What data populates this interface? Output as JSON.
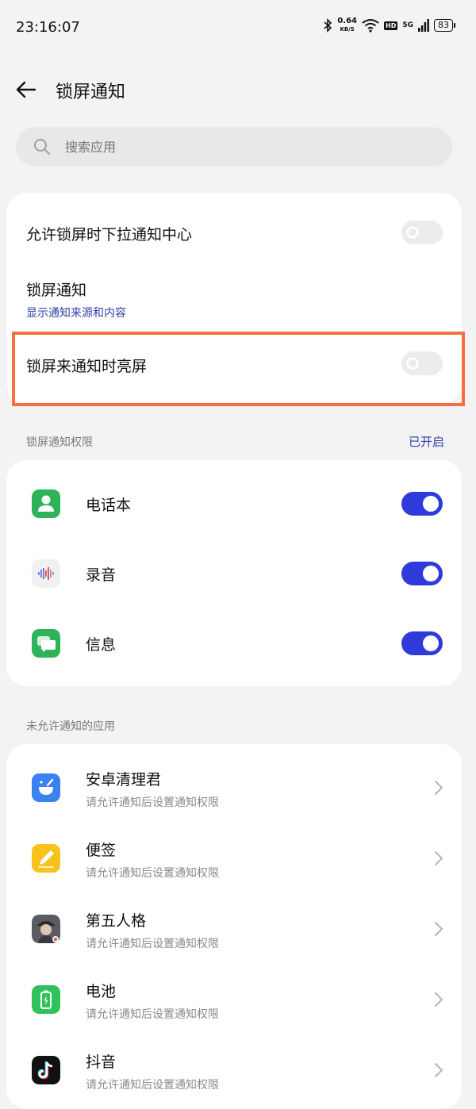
{
  "status_bar": {
    "time": "23:16:07",
    "net_speed_value": "0.64",
    "net_speed_unit": "KB/S",
    "hd_label": "HD",
    "signal_label": "5G",
    "battery_level": "83"
  },
  "header": {
    "title": "锁屏通知"
  },
  "search": {
    "placeholder": "搜索应用"
  },
  "settings": {
    "pull_down": {
      "label": "允许锁屏时下拉通知中心",
      "enabled": false
    },
    "lock_notification": {
      "label": "锁屏通知",
      "value": "显示通知来源和内容"
    },
    "wake_screen": {
      "label": "锁屏来通知时亮屏",
      "enabled": false
    }
  },
  "permissions_section": {
    "label": "锁屏通知权限",
    "status": "已开启",
    "apps": [
      {
        "name": "电话本",
        "icon": "phonebook-icon",
        "enabled": true
      },
      {
        "name": "录音",
        "icon": "recorder-icon",
        "enabled": true
      },
      {
        "name": "信息",
        "icon": "messages-icon",
        "enabled": true
      }
    ]
  },
  "disallowed_section": {
    "label": "未允许通知的应用",
    "apps": [
      {
        "name": "安卓清理君",
        "sub": "请允许通知后设置通知权限",
        "icon": "cleaner-icon"
      },
      {
        "name": "便签",
        "sub": "请允许通知后设置通知权限",
        "icon": "notes-icon"
      },
      {
        "name": "第五人格",
        "sub": "请允许通知后设置通知权限",
        "icon": "identity-v-icon"
      },
      {
        "name": "电池",
        "sub": "请允许通知后设置通知权限",
        "icon": "battery-app-icon"
      },
      {
        "name": "抖音",
        "sub": "请允许通知后设置通知权限",
        "icon": "douyin-icon"
      }
    ]
  },
  "colors": {
    "accent": "#2f3adb",
    "link": "#2f3ea8",
    "highlight": "#f47043"
  }
}
